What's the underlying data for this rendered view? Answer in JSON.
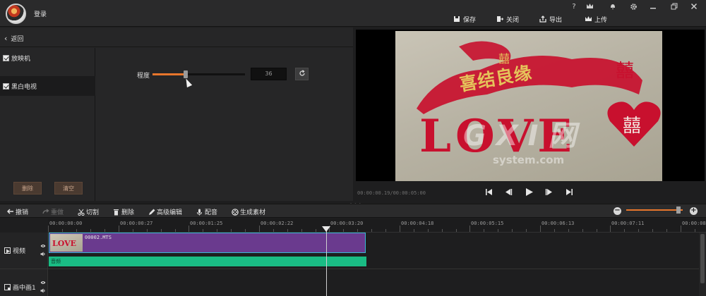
{
  "header": {
    "login_label": "登录",
    "save_label": "保存",
    "close_label": "关闭",
    "export_label": "导出",
    "upload_label": "上传",
    "help_label": "?"
  },
  "panel": {
    "back_label": "返回",
    "effects": [
      {
        "label": "放映机",
        "checked": true
      },
      {
        "label": "黑白电视",
        "checked": true,
        "selected": true
      }
    ],
    "delete_label": "删除",
    "clear_label": "清空",
    "param_label": "程度",
    "param_value": "36",
    "param_fraction": 0.36
  },
  "preview": {
    "timecode": "00:00:00.19/00:00:05:00",
    "photo_text": {
      "top_banner": "喜结良缘",
      "top_tag": "囍",
      "main": "LOVE",
      "heart_char": "囍",
      "corner_char": "囍"
    },
    "watermark_main": "G X I 网",
    "watermark_sub": "system.com"
  },
  "editbar": {
    "undo_label": "撤销",
    "redo_label": "重做",
    "cut_label": "切割",
    "delete_label": "删除",
    "advanced_label": "高级编辑",
    "dub_label": "配音",
    "generate_label": "生成素材",
    "zoom_fraction": 0.92
  },
  "timeline": {
    "ticks": [
      "00:00:00:00",
      "00:00:00:27",
      "00:00:01:25",
      "00:00:02:22",
      "00:00:03:20",
      "00:00:04:18",
      "00:00:05:15",
      "00:00:06:13",
      "00:00:07:11",
      "00:00:08:0"
    ],
    "tracks": [
      {
        "label": "视频"
      },
      {
        "label": "画中画1"
      }
    ],
    "clip_name": "00002.MTS",
    "audio_label": "音频"
  },
  "colors": {
    "accent": "#e8762c",
    "clip": "#6a3a8e",
    "clip_border": "#39b9d6",
    "audio": "#1abc84",
    "photo_red": "#c8102e",
    "photo_gold": "#e5c35a"
  }
}
